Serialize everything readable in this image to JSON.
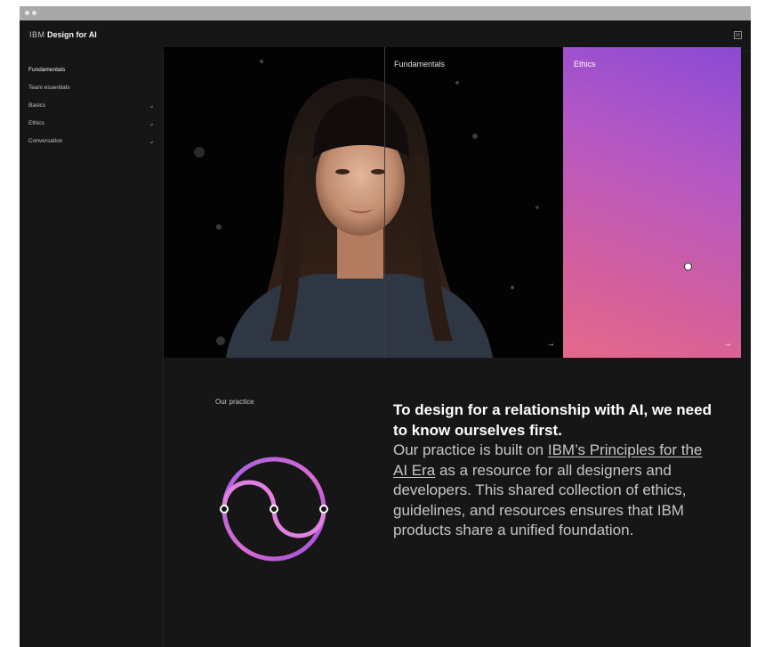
{
  "header": {
    "brand_prefix": "IBM",
    "brand_title": "Design for AI",
    "menu_icon": "menu-icon"
  },
  "sidebar": {
    "items": [
      {
        "label": "Fundamentals",
        "has_chevron": false
      },
      {
        "label": "Team essentials",
        "has_chevron": false
      },
      {
        "label": "Basics",
        "has_chevron": true
      },
      {
        "label": "Ethics",
        "has_chevron": true
      },
      {
        "label": "Conversation",
        "has_chevron": true
      }
    ],
    "chevron_glyph": "⌄"
  },
  "hero": {
    "panels": [
      {
        "label": "Fundamentals",
        "arrow": "→"
      },
      {
        "label": "Ethics",
        "arrow": "→"
      }
    ]
  },
  "practice": {
    "section_label": "Our practice",
    "headline": "To design for a relationship with AI, we need to know ourselves first.",
    "body_before_link": "Our practice is built on ",
    "link_text": "IBM’s Principles for the AI Era",
    "body_after_link": " as a resource for all designers and developers. This shared collection of ethics, guidelines, and resources ensures that IBM products share a unified foundation."
  },
  "colors": {
    "background": "#161616",
    "accent_purple": "#8a4ad4",
    "accent_pink": "#e46a8a"
  }
}
